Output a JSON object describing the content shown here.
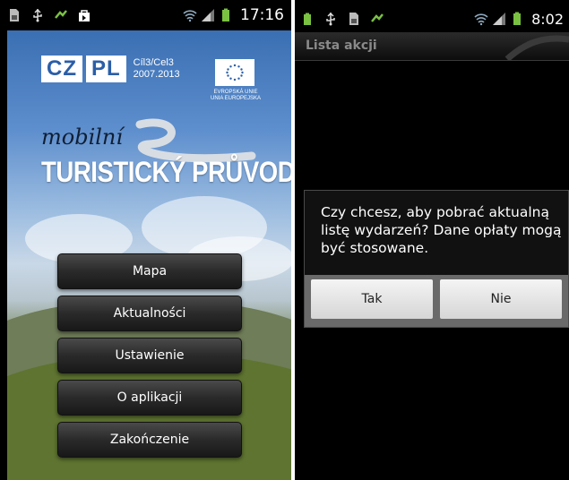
{
  "left_screen": {
    "status_bar": {
      "time": "17:16"
    },
    "logos": {
      "czpl_cz": "CZ",
      "czpl_pl": "PL",
      "cil_line1": "Cíl3/Cel3",
      "cil_line2": "2007.2013",
      "eu_line1": "EVROPSKÁ UNIE",
      "eu_line2": "UNIA EUROPEJSKA"
    },
    "app_subtitle": "mobilní",
    "app_title": "TURISTICKÝ PRŮVODCE",
    "menu": [
      "Mapa",
      "Aktualności",
      "Ustawienie",
      "O aplikacji",
      "Zakończenie"
    ]
  },
  "right_screen": {
    "status_bar": {
      "time": "8:02"
    },
    "title": "Lista akcji",
    "dialog": {
      "message": "Czy chcesz, aby pobrać aktualną listę wydarzeń? Dane opłaty mogą być stosowane.",
      "buttons": [
        "Tak",
        "Nie"
      ]
    }
  },
  "icons": [
    "sd-card-icon",
    "usb-icon",
    "sync-icon",
    "bag-icon",
    "wifi-icon",
    "signal-icon",
    "battery-icon",
    "eu-stars-icon"
  ],
  "colors": {
    "menu_button": "#242424",
    "title_blue": "#2b5ea8",
    "battery_green": "#7ac142"
  }
}
